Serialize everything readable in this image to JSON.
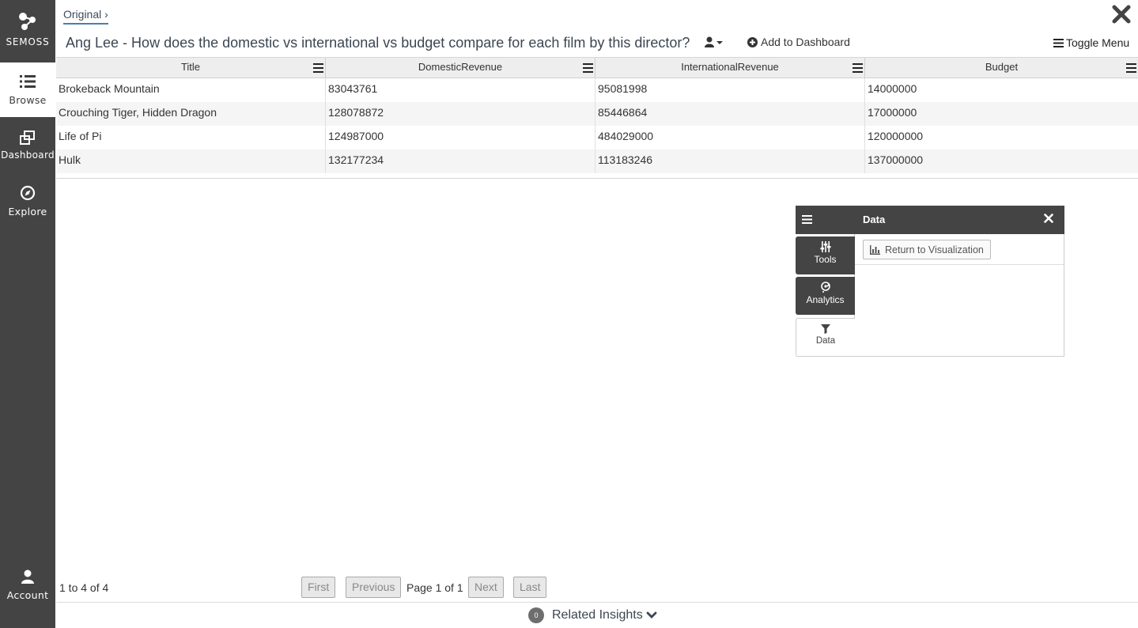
{
  "sidebar": {
    "logo_label": "SEMOSS",
    "items": [
      {
        "label": "Browse"
      },
      {
        "label": "Dashboard"
      },
      {
        "label": "Explore"
      }
    ],
    "account_label": "Account"
  },
  "header": {
    "breadcrumb": "Original",
    "title": "Ang Lee - How does the domestic vs international vs budget compare for each film by this director?",
    "add_to_dashboard": "Add to Dashboard",
    "toggle_menu": "Toggle Menu"
  },
  "table": {
    "columns": [
      "Title",
      "DomesticRevenue",
      "InternationalRevenue",
      "Budget"
    ],
    "rows": [
      [
        "Brokeback Mountain",
        "83043761",
        "95081998",
        "14000000"
      ],
      [
        "Crouching Tiger, Hidden Dragon",
        "128078872",
        "85446864",
        "17000000"
      ],
      [
        "Life of Pi",
        "124987000",
        "484029000",
        "120000000"
      ],
      [
        "Hulk",
        "132177234",
        "113183246",
        "137000000"
      ]
    ]
  },
  "panel": {
    "title": "Data",
    "return_button": "Return to Visualization",
    "tabs": [
      "Tools",
      "Analytics",
      "Data"
    ]
  },
  "pagination": {
    "count_text": "1 to 4 of 4",
    "first": "First",
    "previous": "Previous",
    "page_text": "Page 1 of 1",
    "next": "Next",
    "last": "Last"
  },
  "related": {
    "count": "0",
    "label": "Related Insights"
  }
}
